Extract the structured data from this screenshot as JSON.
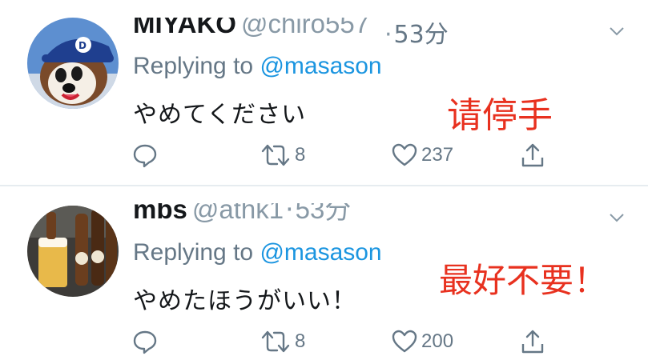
{
  "tweets": [
    {
      "display_name": "MIYAKO",
      "handle": "@chiro557",
      "time": "53分",
      "replying_prefix": "Replying to",
      "replying_handle": "@masason",
      "text": "やめてください",
      "overlay_text": "请停手",
      "retweets": "8",
      "likes": "237"
    },
    {
      "display_name": "mbs",
      "handle": "@athk1",
      "time": "53分",
      "replying_prefix": "Replying to",
      "replying_handle": "@masason",
      "text": "やめたほうがいい！",
      "overlay_text": "最好不要！",
      "retweets": "8",
      "likes": "200"
    }
  ],
  "icons": [
    "reply-icon",
    "retweet-icon",
    "like-icon",
    "share-icon",
    "chevron-down-icon"
  ],
  "colors": {
    "link": "#1b95e0",
    "meta": "#657786",
    "overlay": "#e8311f",
    "divider": "#e6ecf0"
  }
}
